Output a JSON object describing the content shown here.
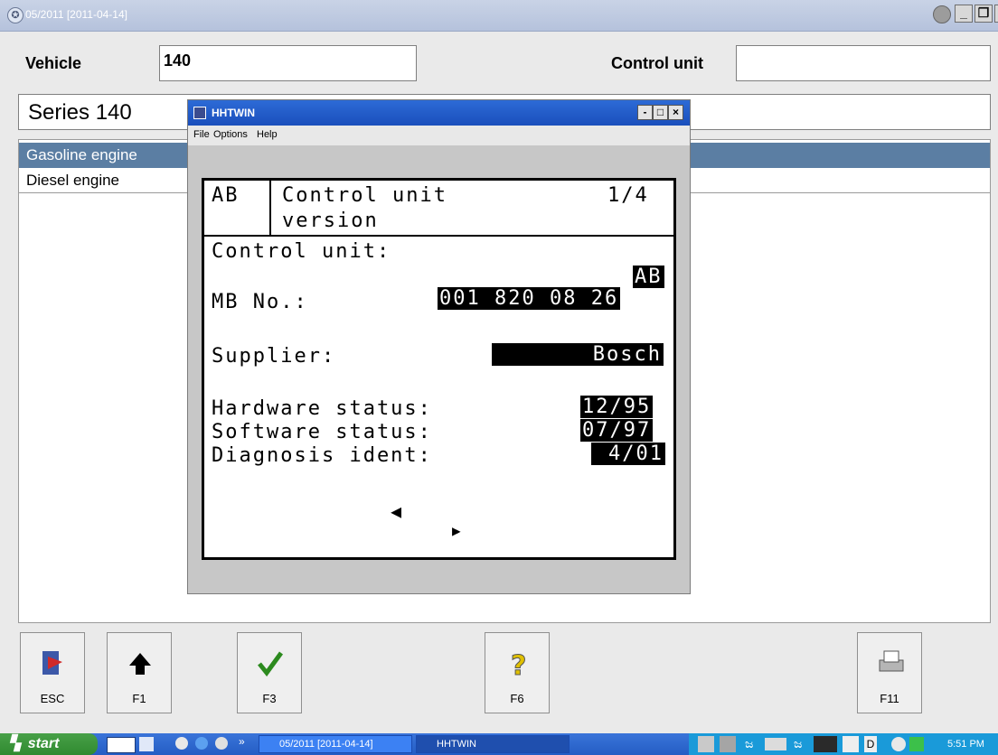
{
  "window": {
    "title": "05/2011 [2011-04-14]"
  },
  "header": {
    "vehicle_label": "Vehicle",
    "vehicle_value": "140",
    "control_unit_label": "Control unit",
    "control_unit_value": "",
    "series_value": "Series 140"
  },
  "list": {
    "items": [
      {
        "label": "Gasoline engine",
        "selected": true
      },
      {
        "label": "Diesel engine",
        "selected": false
      }
    ]
  },
  "dialog": {
    "title": "HHTWIN",
    "menu": [
      "File",
      "Options",
      "Help"
    ],
    "screen": {
      "code": "AB",
      "heading_line1": "Control unit",
      "heading_line2": "version",
      "page": "1/4",
      "control_unit_label": "Control unit:",
      "control_unit_value": "AB",
      "mb_no_label": "MB No.:",
      "mb_no_value": "001 820 08 26",
      "supplier_label": "Supplier:",
      "supplier_value": "Bosch",
      "hardware_label": "Hardware status:",
      "hardware_value": "12/95",
      "software_label": "Software status:",
      "software_value": "07/97",
      "diag_label": "Diagnosis ident:",
      "diag_value": "4/01"
    }
  },
  "buttons": [
    {
      "label": "ESC",
      "icon": "exit-door-icon"
    },
    {
      "label": "F1",
      "icon": "arrow-up-icon"
    },
    {
      "label": "F3",
      "icon": "checkmark-icon"
    },
    {
      "label": "F6",
      "icon": "help-question-icon"
    },
    {
      "label": "F11",
      "icon": "printer-icon"
    }
  ],
  "taskbar": {
    "start_label": "start",
    "tasks": [
      "05/2011 [2011-04-14]",
      "HHTWIN"
    ],
    "clock": "5:51 PM"
  },
  "colors": {
    "selected_row": "#5b7ea3",
    "dialog_titlebar": "#1a4fbc",
    "taskbar": "#245dc4"
  }
}
